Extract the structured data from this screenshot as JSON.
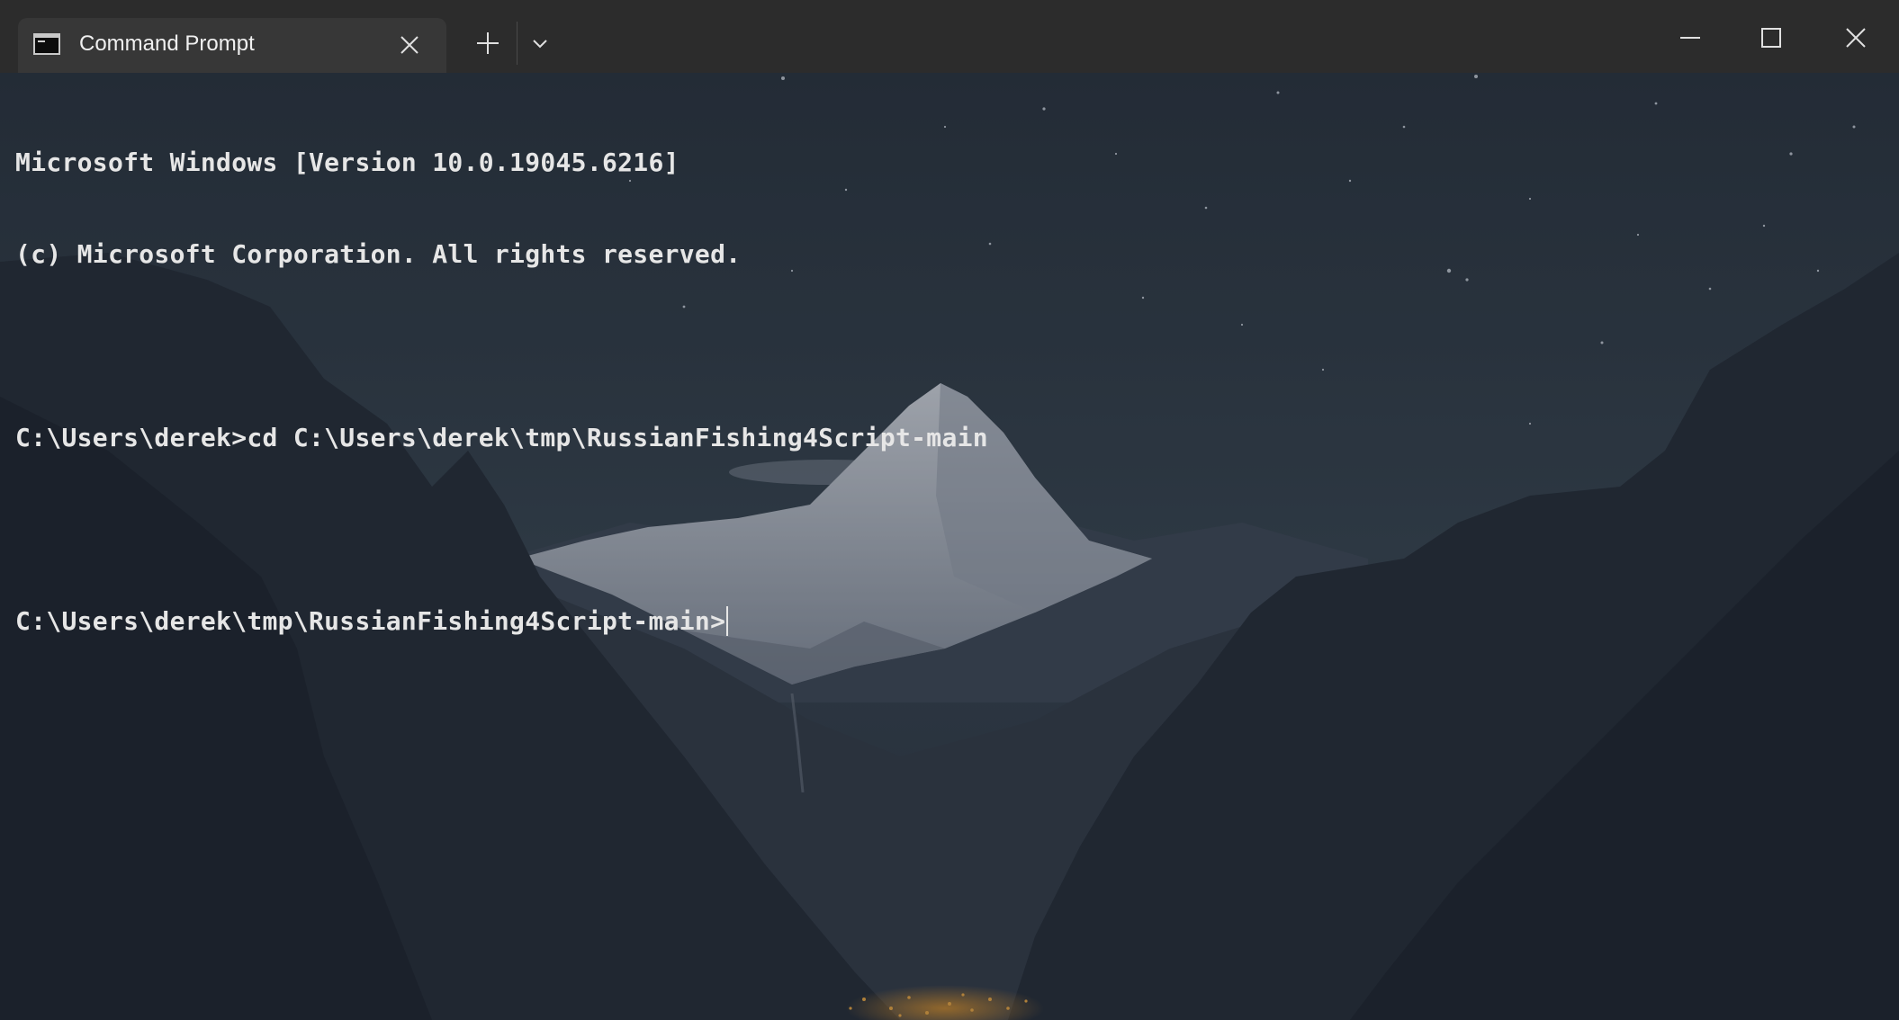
{
  "window": {
    "tab_title": "Command Prompt",
    "tab_icon": "command-prompt-icon",
    "new_tab_icon": "plus-icon",
    "dropdown_icon": "chevron-down-icon",
    "controls": [
      "minimize-icon",
      "maximize-icon",
      "close-icon"
    ]
  },
  "terminal": {
    "lines": [
      "Microsoft Windows [Version 10.0.19045.6216]",
      "(c) Microsoft Corporation. All rights reserved.",
      "",
      "C:\\Users\\derek>cd C:\\Users\\derek\\tmp\\RussianFishing4Script-main",
      "",
      "C:\\Users\\derek\\tmp\\RussianFishing4Script-main>"
    ],
    "text_color": "#e6e6e6",
    "background": "night mountain landscape with starry sky"
  },
  "colors": {
    "titlebar": "#2c2c2c",
    "tab_active": "#373737",
    "sky_top": "#27313c",
    "mountains": "#1e2531"
  }
}
